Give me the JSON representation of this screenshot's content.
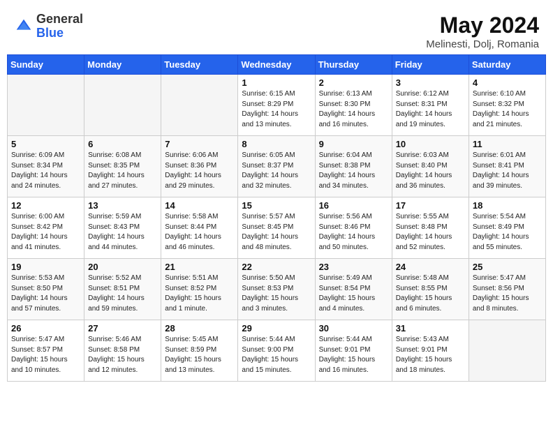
{
  "header": {
    "logo_general": "General",
    "logo_blue": "Blue",
    "month": "May 2024",
    "location": "Melinesti, Dolj, Romania"
  },
  "days_of_week": [
    "Sunday",
    "Monday",
    "Tuesday",
    "Wednesday",
    "Thursday",
    "Friday",
    "Saturday"
  ],
  "weeks": [
    [
      {
        "day": "",
        "info": ""
      },
      {
        "day": "",
        "info": ""
      },
      {
        "day": "",
        "info": ""
      },
      {
        "day": "1",
        "info": "Sunrise: 6:15 AM\nSunset: 8:29 PM\nDaylight: 14 hours\nand 13 minutes."
      },
      {
        "day": "2",
        "info": "Sunrise: 6:13 AM\nSunset: 8:30 PM\nDaylight: 14 hours\nand 16 minutes."
      },
      {
        "day": "3",
        "info": "Sunrise: 6:12 AM\nSunset: 8:31 PM\nDaylight: 14 hours\nand 19 minutes."
      },
      {
        "day": "4",
        "info": "Sunrise: 6:10 AM\nSunset: 8:32 PM\nDaylight: 14 hours\nand 21 minutes."
      }
    ],
    [
      {
        "day": "5",
        "info": "Sunrise: 6:09 AM\nSunset: 8:34 PM\nDaylight: 14 hours\nand 24 minutes."
      },
      {
        "day": "6",
        "info": "Sunrise: 6:08 AM\nSunset: 8:35 PM\nDaylight: 14 hours\nand 27 minutes."
      },
      {
        "day": "7",
        "info": "Sunrise: 6:06 AM\nSunset: 8:36 PM\nDaylight: 14 hours\nand 29 minutes."
      },
      {
        "day": "8",
        "info": "Sunrise: 6:05 AM\nSunset: 8:37 PM\nDaylight: 14 hours\nand 32 minutes."
      },
      {
        "day": "9",
        "info": "Sunrise: 6:04 AM\nSunset: 8:38 PM\nDaylight: 14 hours\nand 34 minutes."
      },
      {
        "day": "10",
        "info": "Sunrise: 6:03 AM\nSunset: 8:40 PM\nDaylight: 14 hours\nand 36 minutes."
      },
      {
        "day": "11",
        "info": "Sunrise: 6:01 AM\nSunset: 8:41 PM\nDaylight: 14 hours\nand 39 minutes."
      }
    ],
    [
      {
        "day": "12",
        "info": "Sunrise: 6:00 AM\nSunset: 8:42 PM\nDaylight: 14 hours\nand 41 minutes."
      },
      {
        "day": "13",
        "info": "Sunrise: 5:59 AM\nSunset: 8:43 PM\nDaylight: 14 hours\nand 44 minutes."
      },
      {
        "day": "14",
        "info": "Sunrise: 5:58 AM\nSunset: 8:44 PM\nDaylight: 14 hours\nand 46 minutes."
      },
      {
        "day": "15",
        "info": "Sunrise: 5:57 AM\nSunset: 8:45 PM\nDaylight: 14 hours\nand 48 minutes."
      },
      {
        "day": "16",
        "info": "Sunrise: 5:56 AM\nSunset: 8:46 PM\nDaylight: 14 hours\nand 50 minutes."
      },
      {
        "day": "17",
        "info": "Sunrise: 5:55 AM\nSunset: 8:48 PM\nDaylight: 14 hours\nand 52 minutes."
      },
      {
        "day": "18",
        "info": "Sunrise: 5:54 AM\nSunset: 8:49 PM\nDaylight: 14 hours\nand 55 minutes."
      }
    ],
    [
      {
        "day": "19",
        "info": "Sunrise: 5:53 AM\nSunset: 8:50 PM\nDaylight: 14 hours\nand 57 minutes."
      },
      {
        "day": "20",
        "info": "Sunrise: 5:52 AM\nSunset: 8:51 PM\nDaylight: 14 hours\nand 59 minutes."
      },
      {
        "day": "21",
        "info": "Sunrise: 5:51 AM\nSunset: 8:52 PM\nDaylight: 15 hours\nand 1 minute."
      },
      {
        "day": "22",
        "info": "Sunrise: 5:50 AM\nSunset: 8:53 PM\nDaylight: 15 hours\nand 3 minutes."
      },
      {
        "day": "23",
        "info": "Sunrise: 5:49 AM\nSunset: 8:54 PM\nDaylight: 15 hours\nand 4 minutes."
      },
      {
        "day": "24",
        "info": "Sunrise: 5:48 AM\nSunset: 8:55 PM\nDaylight: 15 hours\nand 6 minutes."
      },
      {
        "day": "25",
        "info": "Sunrise: 5:47 AM\nSunset: 8:56 PM\nDaylight: 15 hours\nand 8 minutes."
      }
    ],
    [
      {
        "day": "26",
        "info": "Sunrise: 5:47 AM\nSunset: 8:57 PM\nDaylight: 15 hours\nand 10 minutes."
      },
      {
        "day": "27",
        "info": "Sunrise: 5:46 AM\nSunset: 8:58 PM\nDaylight: 15 hours\nand 12 minutes."
      },
      {
        "day": "28",
        "info": "Sunrise: 5:45 AM\nSunset: 8:59 PM\nDaylight: 15 hours\nand 13 minutes."
      },
      {
        "day": "29",
        "info": "Sunrise: 5:44 AM\nSunset: 9:00 PM\nDaylight: 15 hours\nand 15 minutes."
      },
      {
        "day": "30",
        "info": "Sunrise: 5:44 AM\nSunset: 9:01 PM\nDaylight: 15 hours\nand 16 minutes."
      },
      {
        "day": "31",
        "info": "Sunrise: 5:43 AM\nSunset: 9:01 PM\nDaylight: 15 hours\nand 18 minutes."
      },
      {
        "day": "",
        "info": ""
      }
    ]
  ]
}
